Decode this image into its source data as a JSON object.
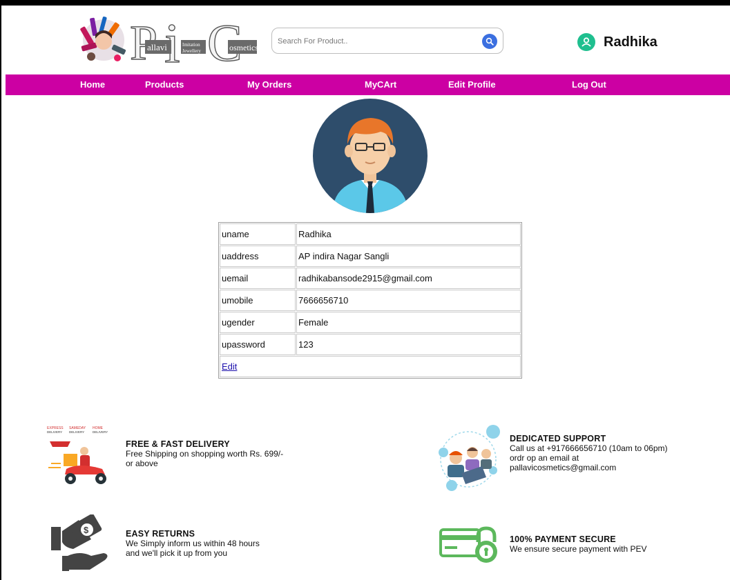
{
  "header": {
    "logo": {
      "title": "Pallavi Imitation Jewellery Cosmetics",
      "letters": [
        "P",
        "i",
        "C"
      ],
      "words": [
        "allavi",
        "Imitation",
        "Jewellery",
        "osmetics"
      ]
    },
    "search": {
      "placeholder": "Search For Product.."
    },
    "user": {
      "name": "Radhika"
    }
  },
  "nav": {
    "items": [
      "Home",
      "Products",
      "My Orders",
      "MyCArt",
      "Edit Profile",
      "Log Out"
    ]
  },
  "profile": {
    "rows": [
      {
        "key": "uname",
        "value": "Radhika"
      },
      {
        "key": "uaddress",
        "value": "AP indira Nagar Sangli"
      },
      {
        "key": "uemail",
        "value": "radhikabansode2915@gmail.com"
      },
      {
        "key": "umobile",
        "value": "7666656710"
      },
      {
        "key": "ugender",
        "value": "Female"
      },
      {
        "key": "upassword",
        "value": "123"
      }
    ],
    "edit_label": "Edit"
  },
  "features": {
    "delivery": {
      "title": "FREE & FAST DELIVERY",
      "text": "Free Shipping on shopping worth  Rs. 699/-\n or above"
    },
    "support": {
      "title": "DEDICATED SUPPORT",
      "text": "Call us at +917666656710 (10am to 06pm)\nordr op an email at\npallavicosmetics@gmail.com"
    },
    "returns": {
      "title": "EASY RETURNS",
      "text": "We Simply inform us within 48 hours\nand we'll pick it up from you"
    },
    "payment": {
      "title": "100% PAYMENT SECURE",
      "text": "We ensure secure payment with PEV"
    }
  },
  "colors": {
    "nav_bg": "#cc00a3",
    "search_button": "#3b6fe0",
    "user_icon": "#1fbf8f",
    "payment_icon": "#5cb85c"
  }
}
